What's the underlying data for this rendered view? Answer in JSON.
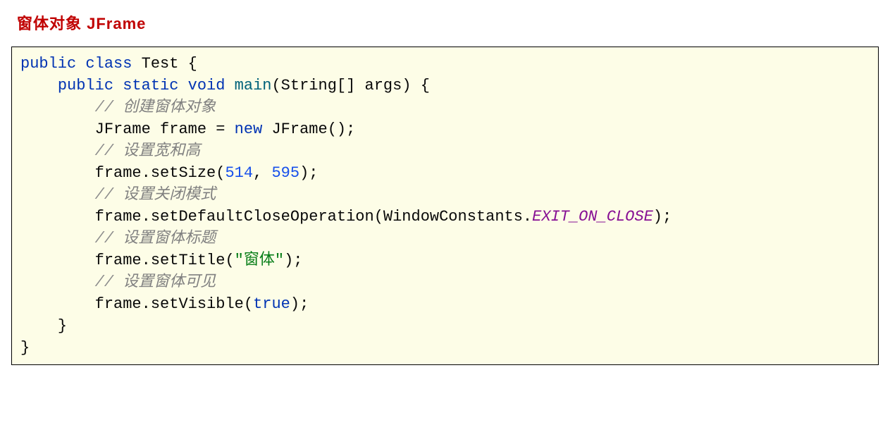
{
  "heading": "窗体对象 JFrame",
  "code": {
    "kw_public1": "public",
    "kw_class": "class",
    "test": "Test",
    "brace_open": "{",
    "kw_public2": "public",
    "kw_static": "static",
    "kw_void": "void",
    "main": "main",
    "main_args": "(String[] args) {",
    "c1_slashes": "// ",
    "c1_text": "创建窗体对象",
    "line_frame_decl_pre": "JFrame frame = ",
    "kw_new": "new",
    "line_frame_decl_post": " JFrame();",
    "c2_slashes": "// ",
    "c2_text": "设置宽和高",
    "setSize_pre": "frame.setSize(",
    "num_514": "514",
    "comma": ", ",
    "num_595": "595",
    "setSize_post": ");",
    "c3_slashes": "// ",
    "c3_text": "设置关闭模式",
    "setDef_pre": "frame.setDefaultCloseOperation(WindowConstants.",
    "const_exit": "EXIT_ON_CLOSE",
    "setDef_post": ");",
    "c4_slashes": "// ",
    "c4_text": "设置窗体标题",
    "setTitle_pre": "frame.setTitle(",
    "str_title": "\"窗体\"",
    "setTitle_post": ");",
    "c5_slashes": "// ",
    "c5_text": "设置窗体可见",
    "setVis_pre": "frame.setVisible(",
    "kw_true": "true",
    "setVis_post": ");",
    "brace_close_method": "}",
    "brace_close_class": "}"
  }
}
